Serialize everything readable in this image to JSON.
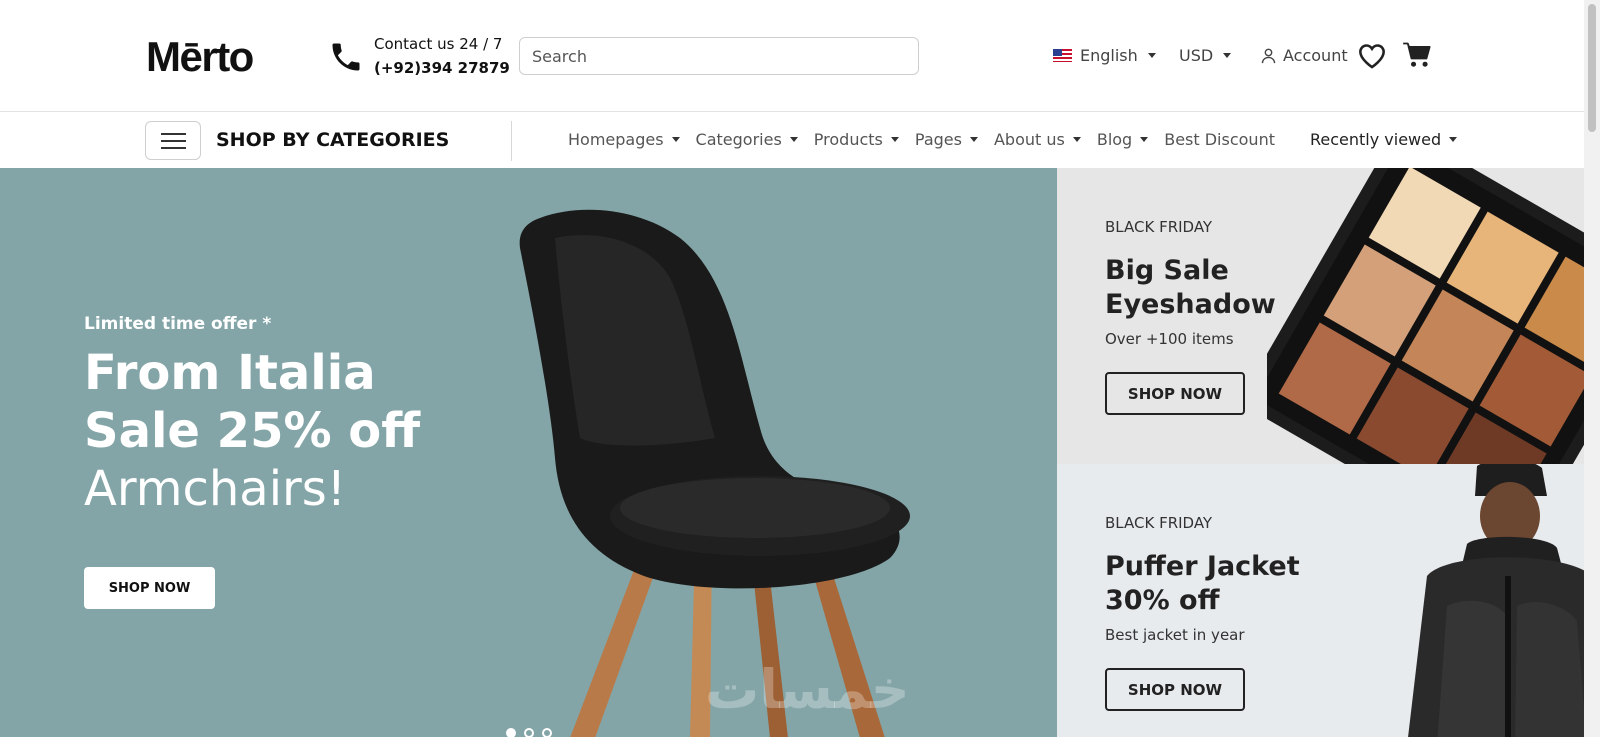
{
  "header": {
    "logo_text": "Mērto",
    "contact_label": "Contact us 24 / 7",
    "contact_phone": "(+92)394 27879",
    "search_placeholder": "Search",
    "language": "English",
    "currency": "USD",
    "account_label": "Account",
    "icons": [
      "phone-icon",
      "flag-us-icon",
      "user-icon",
      "heart-icon",
      "cart-icon"
    ]
  },
  "nav": {
    "categories_label": "SHOP BY CATEGORIES",
    "items": [
      {
        "label": "Homepages",
        "dropdown": true
      },
      {
        "label": "Categories",
        "dropdown": true
      },
      {
        "label": "Products",
        "dropdown": true
      },
      {
        "label": "Pages",
        "dropdown": true
      },
      {
        "label": "About us",
        "dropdown": true
      },
      {
        "label": "Blog",
        "dropdown": true
      },
      {
        "label": "Best Discount",
        "dropdown": false
      }
    ],
    "recently_viewed": "Recently viewed"
  },
  "hero": {
    "kicker": "Limited time offer *",
    "title_line1": "From Italia",
    "title_line2": "Sale 25% off",
    "title_line3": "Armchairs!",
    "button": "SHOP NOW",
    "slide_count": 3,
    "active_slide": 1,
    "watermark": "خمسات",
    "background_color": "#84a5a7"
  },
  "promos": [
    {
      "kicker": "BLACK FRIDAY",
      "title_line1": "Big Sale",
      "title_line2": "Eyeshadow",
      "subtitle": "Over +100 items",
      "button": "SHOP NOW"
    },
    {
      "kicker": "BLACK FRIDAY",
      "title_line1": "Puffer Jacket",
      "title_line2": "30% off",
      "subtitle": "Best jacket in year",
      "button": "SHOP NOW"
    }
  ]
}
